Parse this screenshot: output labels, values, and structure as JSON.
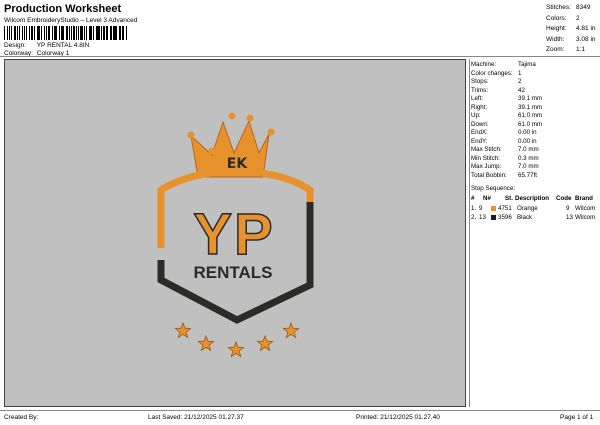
{
  "header": {
    "title": "Production Worksheet",
    "subtitle": "Wilcom EmbroideryStudio – Level 3 Advanced",
    "design_label": "Design:",
    "design_value": "YP RENTAL 4.8IN",
    "colorway_label": "Colorway:",
    "colorway_value": "Colorway 1"
  },
  "stats": [
    {
      "key": "Stitches:",
      "value": "8349"
    },
    {
      "key": "Colors:",
      "value": "2"
    },
    {
      "key": "Height:",
      "value": "4.81 in"
    },
    {
      "key": "Width:",
      "value": "3.08 in"
    },
    {
      "key": "Zoom:",
      "value": "1:1"
    }
  ],
  "machine": [
    {
      "key": "Machine:",
      "value": "Tajima"
    },
    {
      "key": "Color changes:",
      "value": "1"
    },
    {
      "key": "Stops:",
      "value": "2"
    },
    {
      "key": "Trims:",
      "value": "42"
    },
    {
      "key": "Left:",
      "value": "39.1 mm"
    },
    {
      "key": "Right:",
      "value": "39.1 mm"
    },
    {
      "key": "Up:",
      "value": "61.0 mm"
    },
    {
      "key": "Down:",
      "value": "61.0 mm"
    },
    {
      "key": "EndX:",
      "value": "0.00 in"
    },
    {
      "key": "EndY:",
      "value": "0.00 in"
    },
    {
      "key": "Max Stitch:",
      "value": "7.0 mm"
    },
    {
      "key": "Min Stitch:",
      "value": "0.3 mm"
    },
    {
      "key": "Max Jump:",
      "value": "7.0 mm"
    },
    {
      "key": "Total Bobbin:",
      "value": "65.77ft"
    }
  ],
  "sequence": {
    "title": "Stop Sequence:",
    "headers": [
      "#",
      "N#",
      "St.",
      "Description",
      "Code",
      "Brand"
    ],
    "rows": [
      {
        "num": "1.",
        "n": "9",
        "color": "#e8922e",
        "st": "4751",
        "desc": "Orange",
        "code": "9",
        "brand": "Wilcom"
      },
      {
        "num": "2.",
        "n": "13",
        "color": "#1c1c1c",
        "st": "3596",
        "desc": "Black",
        "code": "13",
        "brand": "Wilcom"
      }
    ]
  },
  "design": {
    "big_text": "YP",
    "sub_text": "RENTALS",
    "monogram": "EK"
  },
  "footer": {
    "created": "Created By:",
    "saved": "Last Saved: 21/12/2025 01.27.37",
    "printed": "Printed: 21/12/2025 01.27.40",
    "page": "Page 1 of 1"
  },
  "colors": {
    "orange": "#e8922e",
    "dark": "#2b2b29",
    "bg": "#c0c0c0"
  }
}
